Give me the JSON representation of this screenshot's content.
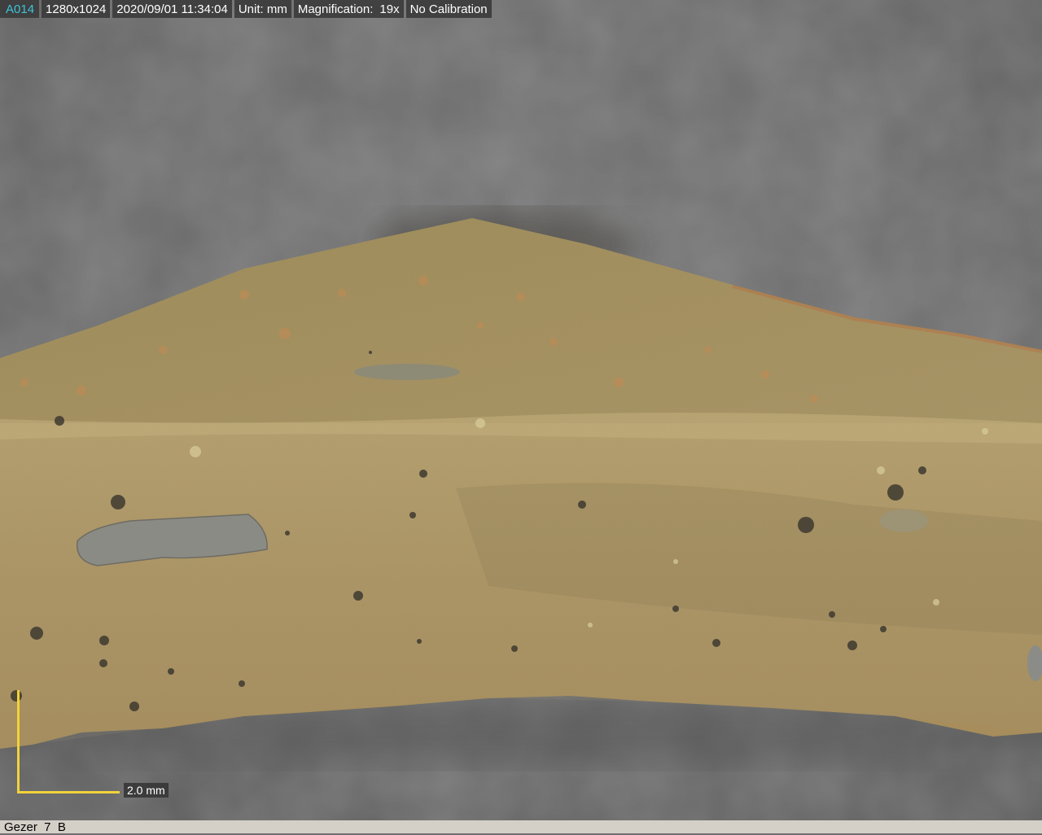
{
  "overlay": {
    "image_id": "A014",
    "resolution": "1280x1024",
    "timestamp": "2020/09/01 11:34:04",
    "unit": "Unit: mm",
    "magnification_label": "Magnification:",
    "magnification_value": "19x",
    "calibration": "No Calibration"
  },
  "scale_bar": {
    "label": "2.0 mm"
  },
  "caption": {
    "text": "Gezer  7  B"
  },
  "colors": {
    "id_text": "#3fc3d8",
    "scale_bar": "#f2d23a",
    "background_gray": "#6e6e6e",
    "sherd_surface": "#a8955f",
    "sherd_edge": "#b39a67"
  },
  "photo": {
    "subject": "pottery-sherd-cross-section"
  }
}
